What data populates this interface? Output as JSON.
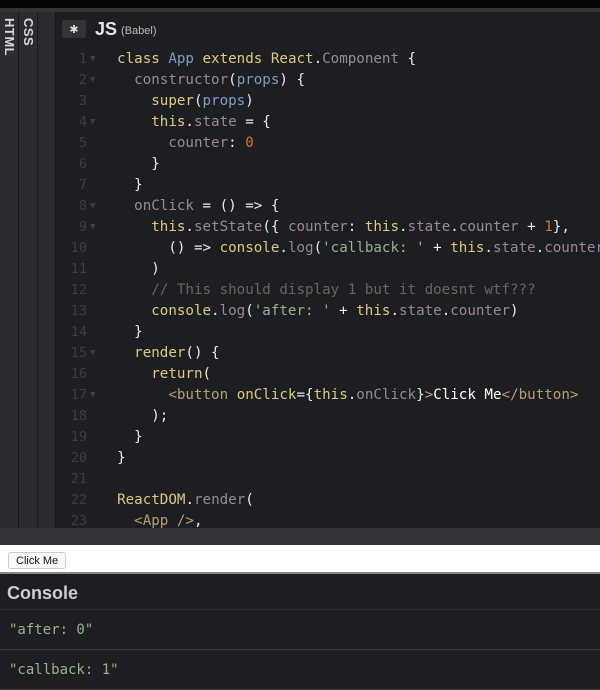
{
  "tabs": {
    "html": "HTML",
    "css": "CSS"
  },
  "editor": {
    "language": "JS",
    "preprocessor": "(Babel)",
    "settings_icon": "gear-icon",
    "lines": [
      {
        "n": "1",
        "fold": true,
        "t": [
          [
            "  ",
            ""
          ],
          [
            "class ",
            "kw"
          ],
          [
            "App ",
            "cls"
          ],
          [
            "extends ",
            "kw"
          ],
          [
            "React",
            "kw"
          ],
          [
            ".",
            ""
          ],
          [
            "Component ",
            "prop"
          ],
          [
            "{",
            ""
          ]
        ]
      },
      {
        "n": "2",
        "fold": true,
        "t": [
          [
            "    ",
            ""
          ],
          [
            "constructor",
            "prop"
          ],
          [
            "(",
            ""
          ],
          [
            "props",
            "cls"
          ],
          [
            ") {",
            ""
          ]
        ]
      },
      {
        "n": "3",
        "fold": false,
        "t": [
          [
            "      ",
            ""
          ],
          [
            "super",
            "kw"
          ],
          [
            "(",
            ""
          ],
          [
            "props",
            "cls"
          ],
          [
            ")",
            ""
          ]
        ]
      },
      {
        "n": "4",
        "fold": true,
        "t": [
          [
            "      ",
            ""
          ],
          [
            "this",
            "kw"
          ],
          [
            ".",
            ""
          ],
          [
            "state ",
            "prop"
          ],
          [
            "= {",
            ""
          ]
        ]
      },
      {
        "n": "5",
        "fold": false,
        "t": [
          [
            "        ",
            ""
          ],
          [
            "counter",
            "prop"
          ],
          [
            ": ",
            ""
          ],
          [
            "0",
            "num2"
          ]
        ]
      },
      {
        "n": "6",
        "fold": false,
        "t": [
          [
            "      }",
            ""
          ]
        ]
      },
      {
        "n": "7",
        "fold": false,
        "t": [
          [
            "    }",
            ""
          ]
        ]
      },
      {
        "n": "8",
        "fold": true,
        "t": [
          [
            "    ",
            ""
          ],
          [
            "onClick ",
            "prop"
          ],
          [
            "= () => {",
            ""
          ]
        ]
      },
      {
        "n": "9",
        "fold": true,
        "t": [
          [
            "      ",
            ""
          ],
          [
            "this",
            "kw"
          ],
          [
            ".",
            ""
          ],
          [
            "setState",
            "prop"
          ],
          [
            "({ ",
            ""
          ],
          [
            "counter",
            "prop"
          ],
          [
            ": ",
            ""
          ],
          [
            "this",
            "kw"
          ],
          [
            ".",
            ""
          ],
          [
            "state",
            "prop"
          ],
          [
            ".",
            ""
          ],
          [
            "counter ",
            "prop"
          ],
          [
            "+ ",
            ""
          ],
          [
            "1",
            "num2"
          ],
          [
            "},",
            ""
          ]
        ]
      },
      {
        "n": "10",
        "fold": false,
        "t": [
          [
            "        () => ",
            ""
          ],
          [
            "console",
            "kw"
          ],
          [
            ".",
            ""
          ],
          [
            "log",
            "prop"
          ],
          [
            "(",
            ""
          ],
          [
            "'callback: '",
            "str"
          ],
          [
            " + ",
            ""
          ],
          [
            "this",
            "kw"
          ],
          [
            ".",
            ""
          ],
          [
            "state",
            "prop"
          ],
          [
            ".",
            ""
          ],
          [
            "counter",
            "prop"
          ],
          [
            ")",
            ""
          ]
        ]
      },
      {
        "n": "11",
        "fold": false,
        "t": [
          [
            "      )",
            ""
          ]
        ]
      },
      {
        "n": "12",
        "fold": false,
        "t": [
          [
            "      ",
            ""
          ],
          [
            "// This should display 1 but it doesnt wtf???",
            "com"
          ]
        ]
      },
      {
        "n": "13",
        "fold": false,
        "t": [
          [
            "      ",
            ""
          ],
          [
            "console",
            "kw"
          ],
          [
            ".",
            ""
          ],
          [
            "log",
            "prop"
          ],
          [
            "(",
            ""
          ],
          [
            "'after: '",
            "str"
          ],
          [
            " + ",
            ""
          ],
          [
            "this",
            "kw"
          ],
          [
            ".",
            ""
          ],
          [
            "state",
            "prop"
          ],
          [
            ".",
            ""
          ],
          [
            "counter",
            "prop"
          ],
          [
            ")",
            ""
          ]
        ]
      },
      {
        "n": "14",
        "fold": false,
        "t": [
          [
            "    }",
            ""
          ]
        ]
      },
      {
        "n": "15",
        "fold": true,
        "t": [
          [
            "    ",
            ""
          ],
          [
            "render",
            "kw"
          ],
          [
            "() {",
            ""
          ]
        ]
      },
      {
        "n": "16",
        "fold": false,
        "t": [
          [
            "      ",
            ""
          ],
          [
            "return",
            "kw"
          ],
          [
            "(",
            ""
          ]
        ]
      },
      {
        "n": "17",
        "fold": true,
        "t": [
          [
            "        ",
            ""
          ],
          [
            "<button ",
            "tag"
          ],
          [
            "onClick",
            "kw"
          ],
          [
            "={",
            ""
          ],
          [
            "this",
            "kw"
          ],
          [
            ".",
            ""
          ],
          [
            "onClick",
            "prop"
          ],
          [
            "}",
            ""
          ],
          [
            ">",
            "tag"
          ],
          [
            "Click Me",
            "w"
          ],
          [
            "</button>",
            "tag"
          ]
        ]
      },
      {
        "n": "18",
        "fold": false,
        "t": [
          [
            "      );",
            ""
          ]
        ]
      },
      {
        "n": "19",
        "fold": false,
        "t": [
          [
            "    }",
            ""
          ]
        ]
      },
      {
        "n": "20",
        "fold": false,
        "t": [
          [
            "  }",
            ""
          ]
        ]
      },
      {
        "n": "21",
        "fold": false,
        "t": []
      },
      {
        "n": "22",
        "fold": false,
        "t": [
          [
            "  ",
            ""
          ],
          [
            "ReactDOM",
            "kw"
          ],
          [
            ".",
            ""
          ],
          [
            "render",
            "prop"
          ],
          [
            "(",
            ""
          ]
        ]
      },
      {
        "n": "23",
        "fold": false,
        "t": [
          [
            "    ",
            ""
          ],
          [
            "<App />",
            "tag"
          ],
          [
            ",",
            ""
          ]
        ]
      }
    ]
  },
  "preview": {
    "button_label": "Click Me"
  },
  "console": {
    "title": "Console",
    "entries": [
      "\"after: 0\"",
      "\"callback: 1\""
    ]
  }
}
